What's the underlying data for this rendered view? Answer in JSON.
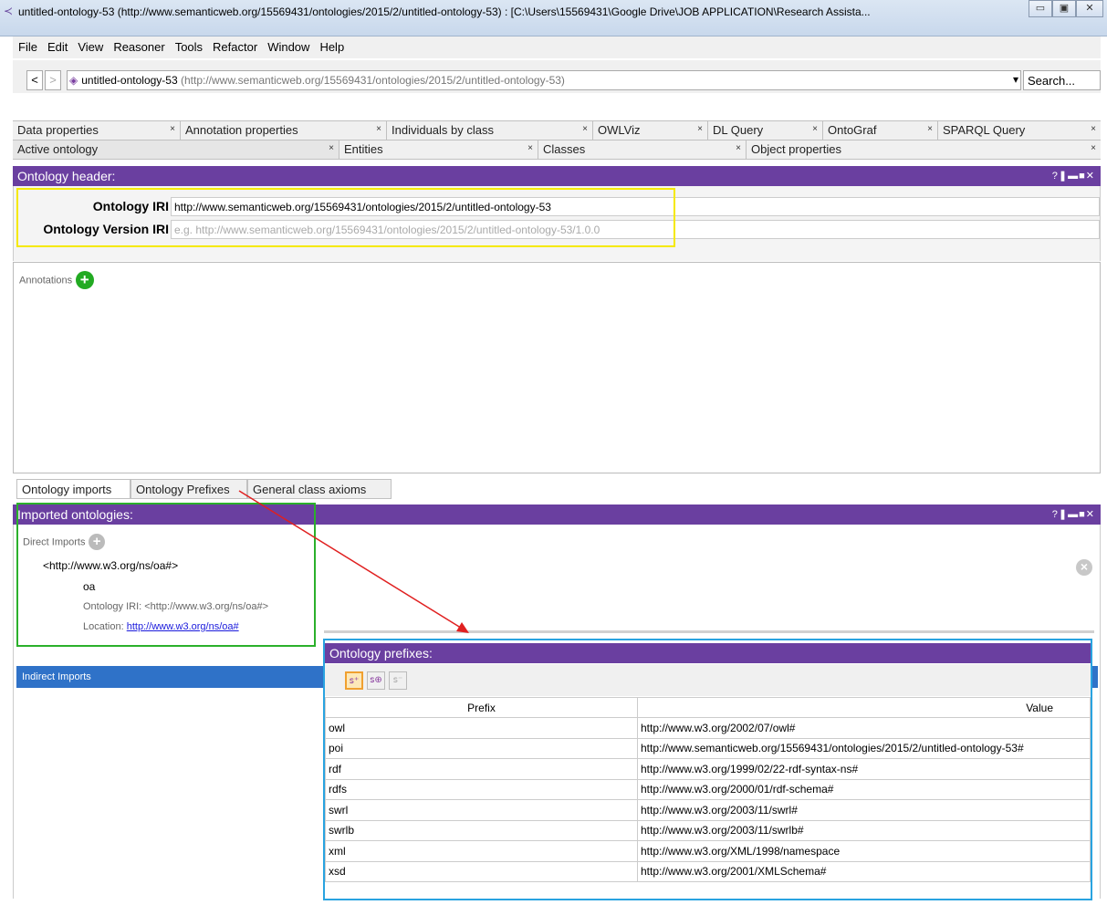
{
  "window": {
    "title": "untitled-ontology-53 (http://www.semanticweb.org/15569431/ontologies/2015/2/untitled-ontology-53) : [C:\\Users\\15569431\\Google Drive\\JOB APPLICATION\\Research Assista...",
    "minimize_glyph": "▭",
    "maximize_glyph": "▣",
    "close_glyph": "✕"
  },
  "menu": [
    "File",
    "Edit",
    "View",
    "Reasoner",
    "Tools",
    "Refactor",
    "Window",
    "Help"
  ],
  "address": {
    "back": "<",
    "forward": ">",
    "name": "untitled-ontology-53",
    "iri": "(http://www.semanticweb.org/15569431/ontologies/2015/2/untitled-ontology-53)",
    "dropdown": "▾",
    "search": "Search..."
  },
  "tabs_row1": [
    "Data properties",
    "Annotation properties",
    "Individuals by class",
    "OWLViz",
    "DL Query",
    "OntoGraf",
    "SPARQL Query"
  ],
  "tabs_row2": [
    "Active ontology",
    "Entities",
    "Classes",
    "Object properties"
  ],
  "tab_close": "×",
  "ontology_header": {
    "title": "Ontology header:",
    "controls": "?❚▬■✕",
    "iri_label": "Ontology IRI",
    "iri_value": "http://www.semanticweb.org/15569431/ontologies/2015/2/untitled-ontology-53",
    "version_label": "Ontology Version IRI",
    "version_placeholder": "e.g. http://www.semanticweb.org/15569431/ontologies/2015/2/untitled-ontology-53/1.0.0",
    "annotations_label": "Annotations",
    "add_glyph": "+"
  },
  "bottom_tabs": [
    "Ontology imports",
    "Ontology Prefixes",
    "General class axioms"
  ],
  "imports": {
    "title": "Imported ontologies:",
    "controls": "?❚▬■✕",
    "direct_label": "Direct Imports",
    "add_glyph": "+",
    "remove_glyph": "×",
    "entry": "<http://www.w3.org/ns/oa#>",
    "name": "oa",
    "iri_line": "Ontology IRI: <http://www.w3.org/ns/oa#>",
    "location_label": "Location:",
    "location_url": "http://www.w3.org/ns/oa#",
    "indirect_label": "Indirect Imports"
  },
  "prefixes": {
    "title": "Ontology prefixes:",
    "toolbar": [
      "add-prefix",
      "generate-prefix",
      "remove-prefix"
    ],
    "col_prefix": "Prefix",
    "col_value": "Value",
    "rows": [
      {
        "prefix": "owl",
        "value": "http://www.w3.org/2002/07/owl#"
      },
      {
        "prefix": "poi",
        "value": "http://www.semanticweb.org/15569431/ontologies/2015/2/untitled-ontology-53#"
      },
      {
        "prefix": "rdf",
        "value": "http://www.w3.org/1999/02/22-rdf-syntax-ns#"
      },
      {
        "prefix": "rdfs",
        "value": "http://www.w3.org/2000/01/rdf-schema#"
      },
      {
        "prefix": "swrl",
        "value": "http://www.w3.org/2003/11/swrl#"
      },
      {
        "prefix": "swrlb",
        "value": "http://www.w3.org/2003/11/swrlb#"
      },
      {
        "prefix": "xml",
        "value": "http://www.w3.org/XML/1998/namespace"
      },
      {
        "prefix": "xsd",
        "value": "http://www.w3.org/2001/XMLSchema#"
      }
    ]
  },
  "colors": {
    "purple_header": "#6a3fa0",
    "highlight_yellow": "#f5e900",
    "highlight_green": "#2bb02b",
    "highlight_blue": "#29a3e0",
    "arrow_red": "#e02020",
    "indirect_blue": "#2f72c8"
  }
}
